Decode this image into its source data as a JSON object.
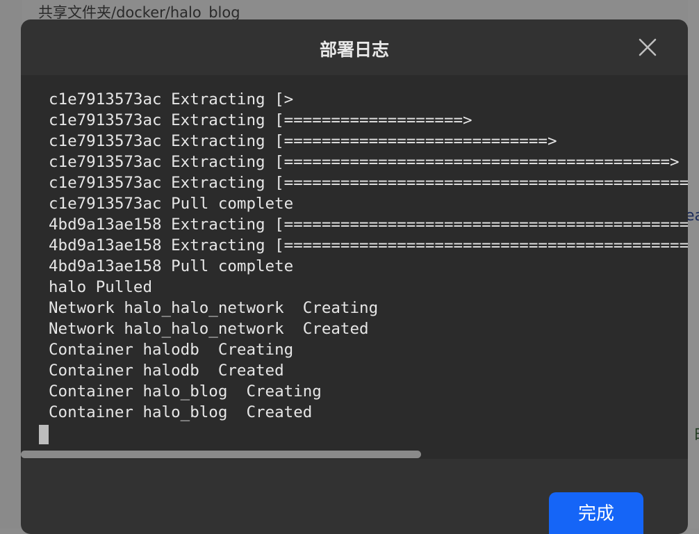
{
  "background": {
    "path": "共享文件夹/docker/halo_blog",
    "fragment_1": "ea",
    "fragment_2": "白"
  },
  "dialog": {
    "title": "部署日志",
    "close_icon": "close-icon",
    "done_label": "完成"
  },
  "log": {
    "lines": [
      "c1e7913573ac Extracting [>",
      "c1e7913573ac Extracting [===================>",
      "c1e7913573ac Extracting [============================>",
      "c1e7913573ac Extracting [=========================================>",
      "c1e7913573ac Extracting [==================================================",
      "c1e7913573ac Pull complete",
      "4bd9a13ae158 Extracting [==================================================",
      "4bd9a13ae158 Extracting [==================================================",
      "4bd9a13ae158 Pull complete",
      "halo Pulled",
      "Network halo_halo_network  Creating",
      "Network halo_halo_network  Created",
      "Container halodb  Creating",
      "Container halodb  Created",
      "Container halo_blog  Creating",
      "Container halo_blog  Created"
    ]
  },
  "scrollbar": {
    "horizontal_position": 0.0
  },
  "colors": {
    "modal_bg": "#323232",
    "log_bg": "#2b2b2b",
    "accent": "#1565f7"
  }
}
